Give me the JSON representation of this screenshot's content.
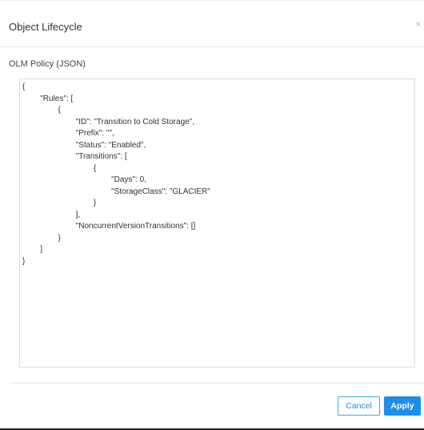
{
  "dialog": {
    "title": "Object Lifecycle",
    "close_glyph": "×"
  },
  "policy": {
    "label": "OLM Policy (JSON)",
    "json_text": "{\n        \"Rules\": [\n                {\n                        \"ID\": \"Transition to Cold Storage\",\n                        \"Prefix\": \"\",\n                        \"Status\": \"Enabled\",\n                        \"Transitions\": [\n                                {\n                                        \"Days\": 0,\n                                        \"StorageClass\": \"GLACIER\"\n                                }\n                        ],\n                        \"NoncurrentVersionTransitions\": []\n                }\n        ]\n}"
  },
  "footer": {
    "cancel_label": "Cancel",
    "apply_label": "Apply"
  },
  "colors": {
    "accent": "#1e8fe6",
    "border": "#dddddd"
  }
}
